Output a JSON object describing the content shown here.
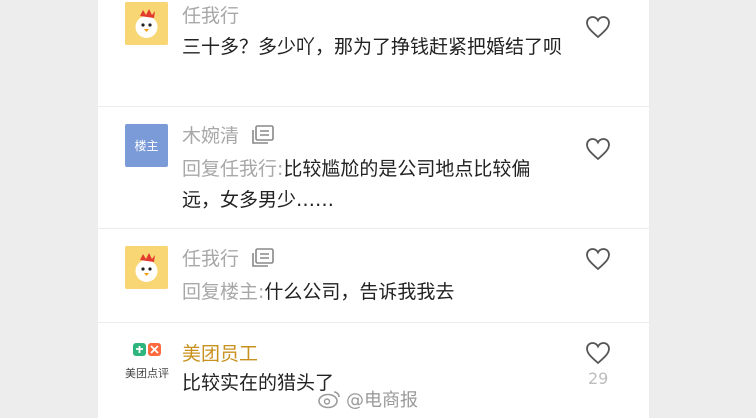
{
  "comments": [
    {
      "name": "任我行",
      "text": "三十多？多少吖，那为了挣钱赶紧把婚结了呗"
    },
    {
      "name": "木婉清",
      "badge": "楼主",
      "reply_prefix": "回复任我行:",
      "text": "比较尴尬的是公司地点比较偏远，女多男少……"
    },
    {
      "name": "任我行",
      "reply_prefix": "回复楼主:",
      "text": "什么公司，告诉我我去"
    },
    {
      "name": "美团员工",
      "brand_label": "美团点评",
      "text": "比较实在的猎头了",
      "likes": "29"
    }
  ],
  "watermark": "@电商报",
  "colors": {
    "name_gray": "#a8a8a8",
    "name_gold": "#c8901c",
    "owner_avatar": "#7b9ad8",
    "chick_avatar": "#f8d673"
  }
}
